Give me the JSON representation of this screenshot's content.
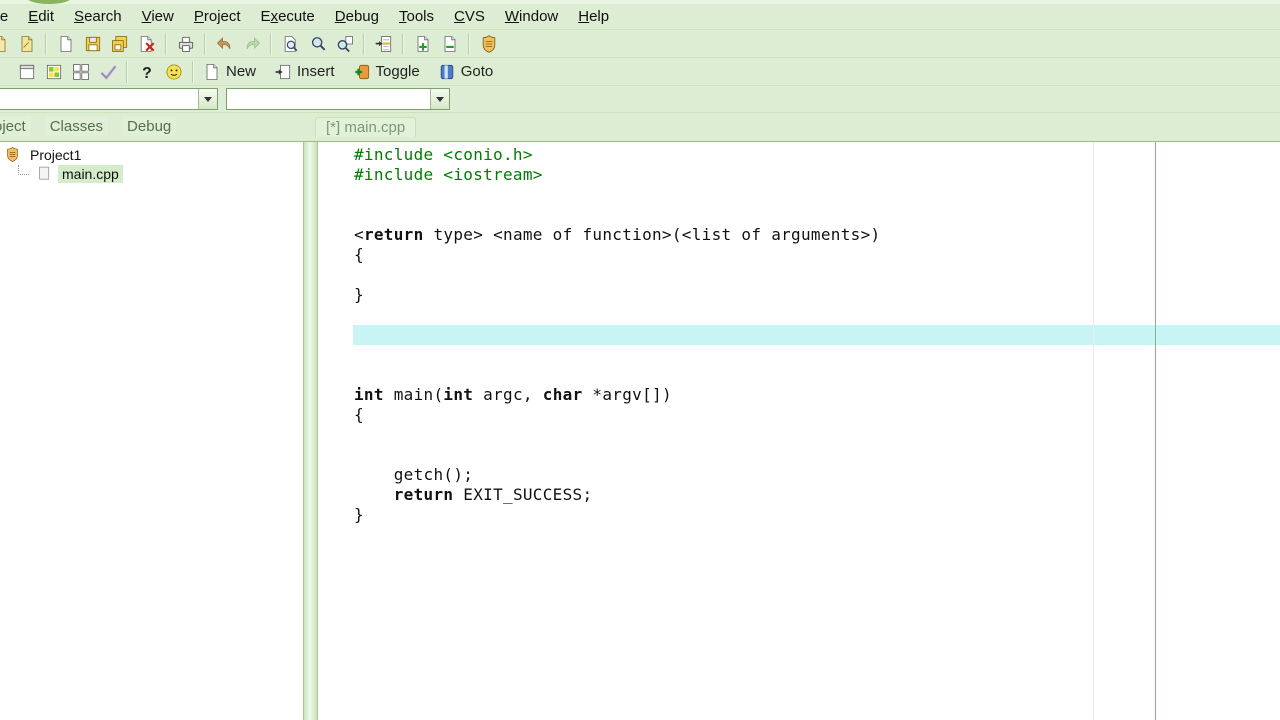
{
  "colors": {
    "header_bg": "#dcedd3",
    "highlight_line": "#c9f4f6",
    "cursor_glow": "#f1ee82",
    "preprocessor_green": "#007c00",
    "margin_line": "#90ad90",
    "selection_bg": "#d5ecca"
  },
  "menu_bar": {
    "items": [
      {
        "label": "File",
        "mnemonic": 0,
        "clipped": true
      },
      {
        "label": "Edit",
        "mnemonic": 0
      },
      {
        "label": "Search",
        "mnemonic": 0
      },
      {
        "label": "View",
        "mnemonic": 0
      },
      {
        "label": "Project",
        "mnemonic": 0
      },
      {
        "label": "Execute",
        "mnemonic": 1
      },
      {
        "label": "Debug",
        "mnemonic": 0
      },
      {
        "label": "Tools",
        "mnemonic": 0
      },
      {
        "label": "CVS",
        "mnemonic": 0
      },
      {
        "label": "Window",
        "mnemonic": 0
      },
      {
        "label": "Help",
        "mnemonic": 0
      }
    ]
  },
  "toolbar_main": {
    "groups": [
      {
        "items": [
          {
            "icon": "doc-yellow",
            "name": "new-source-icon",
            "cut": true
          },
          {
            "icon": "doc-yellow-open",
            "name": "open-project-icon"
          }
        ]
      },
      {
        "items": [
          {
            "icon": "doc-white",
            "name": "new-file-icon"
          },
          {
            "icon": "floppy",
            "name": "save-icon"
          },
          {
            "icon": "floppy-stack",
            "name": "save-all-icon"
          },
          {
            "icon": "doc-close",
            "name": "close-file-icon"
          }
        ]
      },
      {
        "items": [
          {
            "icon": "printer",
            "name": "print-icon"
          }
        ]
      },
      {
        "items": [
          {
            "icon": "undo",
            "name": "undo-icon"
          },
          {
            "icon": "redo",
            "name": "redo-icon"
          }
        ]
      },
      {
        "items": [
          {
            "icon": "find",
            "name": "find-icon"
          },
          {
            "icon": "find-next",
            "name": "find-next-icon"
          },
          {
            "icon": "replace",
            "name": "replace-icon"
          }
        ]
      },
      {
        "items": [
          {
            "icon": "goto-line",
            "name": "goto-line-icon"
          }
        ]
      },
      {
        "items": [
          {
            "icon": "doc-plus",
            "name": "add-unit-icon"
          },
          {
            "icon": "doc-minus",
            "name": "remove-unit-icon"
          }
        ]
      },
      {
        "items": [
          {
            "icon": "shield",
            "name": "project-options-icon"
          }
        ]
      }
    ]
  },
  "toolbar_secondary": {
    "groups": [
      {
        "items": [
          {
            "icon": "squares-mini",
            "name": "panel-layout-icon",
            "cut": true
          },
          {
            "icon": "window",
            "name": "window-icon"
          },
          {
            "icon": "cascade",
            "name": "cascade-windows-icon"
          },
          {
            "icon": "tile",
            "name": "tile-windows-icon"
          },
          {
            "icon": "check",
            "name": "apply-icon"
          }
        ]
      },
      {
        "items": [
          {
            "icon": "question",
            "name": "help-icon"
          },
          {
            "icon": "smiley",
            "name": "about-icon"
          }
        ]
      },
      {
        "items": [
          {
            "icon": "doc-white",
            "name": "new-bookmark-button",
            "label": "New"
          },
          {
            "icon": "insert-doc",
            "name": "insert-bookmark-button",
            "label": "Insert"
          },
          {
            "icon": "toggle",
            "name": "toggle-bookmark-button",
            "label": "Toggle"
          },
          {
            "icon": "goto-blue",
            "name": "goto-bookmark-button",
            "label": "Goto"
          }
        ]
      }
    ]
  },
  "navigation": {
    "combo_left_value": "",
    "combo_right_value": ""
  },
  "left_panel": {
    "tabs": [
      {
        "label": "Project",
        "clipped": true
      },
      {
        "label": "Classes"
      },
      {
        "label": "Debug"
      }
    ],
    "tree": [
      {
        "label": "Project1",
        "icon": "project-shield",
        "level": 0
      },
      {
        "label": "main.cpp",
        "icon": "source-file",
        "level": 1,
        "selected": true
      }
    ]
  },
  "editor": {
    "tab_label": "[*] main.cpp",
    "code_lines": [
      {
        "segments": [
          {
            "text": "#include <conio.h>",
            "style": "preprocessor"
          }
        ]
      },
      {
        "segments": [
          {
            "text": "#include <iostream>",
            "style": "preprocessor"
          }
        ]
      },
      {
        "segments": []
      },
      {
        "segments": []
      },
      {
        "segments": [
          {
            "text": "<"
          },
          {
            "text": "return",
            "style": "keyword"
          },
          {
            "text": " type> <name of function>(<list of arguments>)"
          }
        ]
      },
      {
        "segments": [
          {
            "text": "{"
          }
        ],
        "cursor_glow": true
      },
      {
        "segments": []
      },
      {
        "segments": [
          {
            "text": "}"
          }
        ]
      },
      {
        "segments": []
      },
      {
        "segments": [],
        "highlighted": true
      },
      {
        "segments": []
      },
      {
        "segments": []
      },
      {
        "segments": [
          {
            "text": "int",
            "style": "keyword"
          },
          {
            "text": " main("
          },
          {
            "text": "int",
            "style": "keyword"
          },
          {
            "text": " argc, "
          },
          {
            "text": "char",
            "style": "keyword"
          },
          {
            "text": " *argv[])"
          }
        ]
      },
      {
        "segments": [
          {
            "text": "{"
          }
        ]
      },
      {
        "segments": []
      },
      {
        "segments": []
      },
      {
        "segments": [
          {
            "text": "    getch();"
          }
        ]
      },
      {
        "segments": [
          {
            "text": "    "
          },
          {
            "text": "return",
            "style": "keyword"
          },
          {
            "text": " EXIT_SUCCESS;"
          }
        ]
      },
      {
        "segments": [
          {
            "text": "}"
          }
        ]
      }
    ]
  }
}
